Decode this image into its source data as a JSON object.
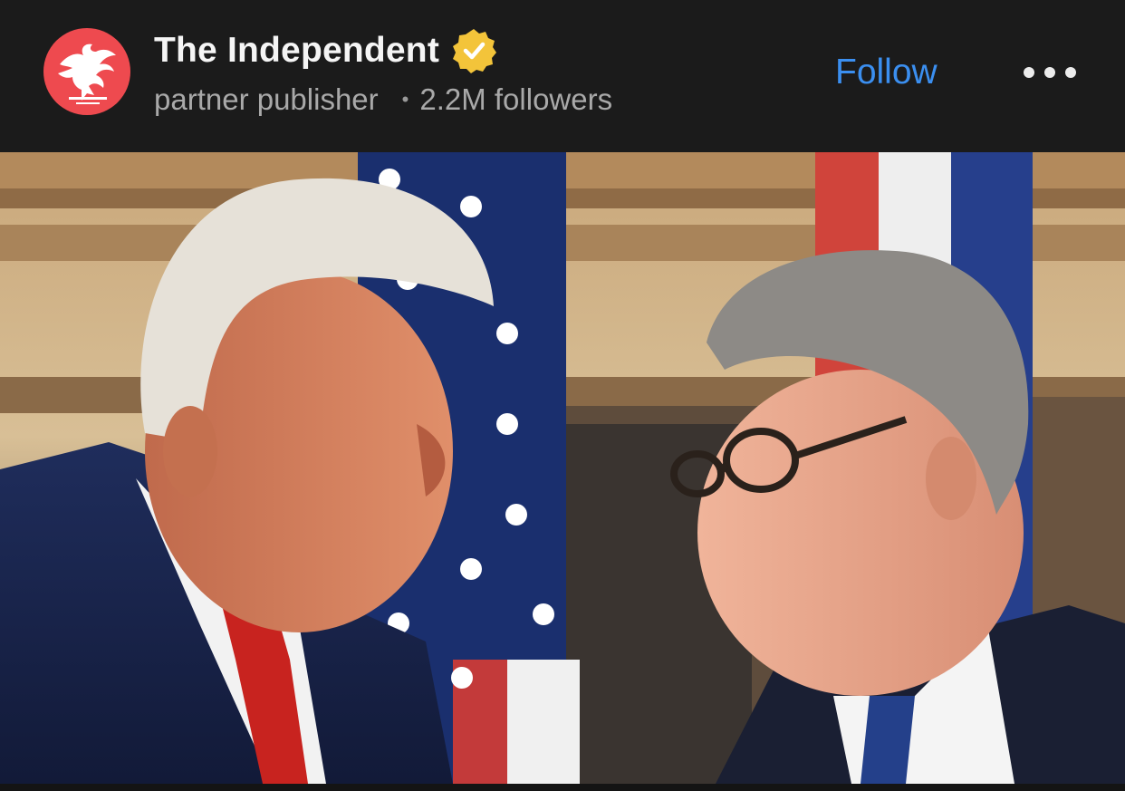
{
  "post": {
    "publisher": {
      "name": "The Independent",
      "badge": "verified-badge",
      "role": "partner publisher",
      "separator": "•",
      "followers": "2.2M followers",
      "avatar_icon": "independent-eagle-logo",
      "avatar_color": "#ee4a4f"
    },
    "follow_label": "Follow",
    "more_icon": "more-horizontal-icon",
    "accent_color": "#3b8ff0"
  }
}
